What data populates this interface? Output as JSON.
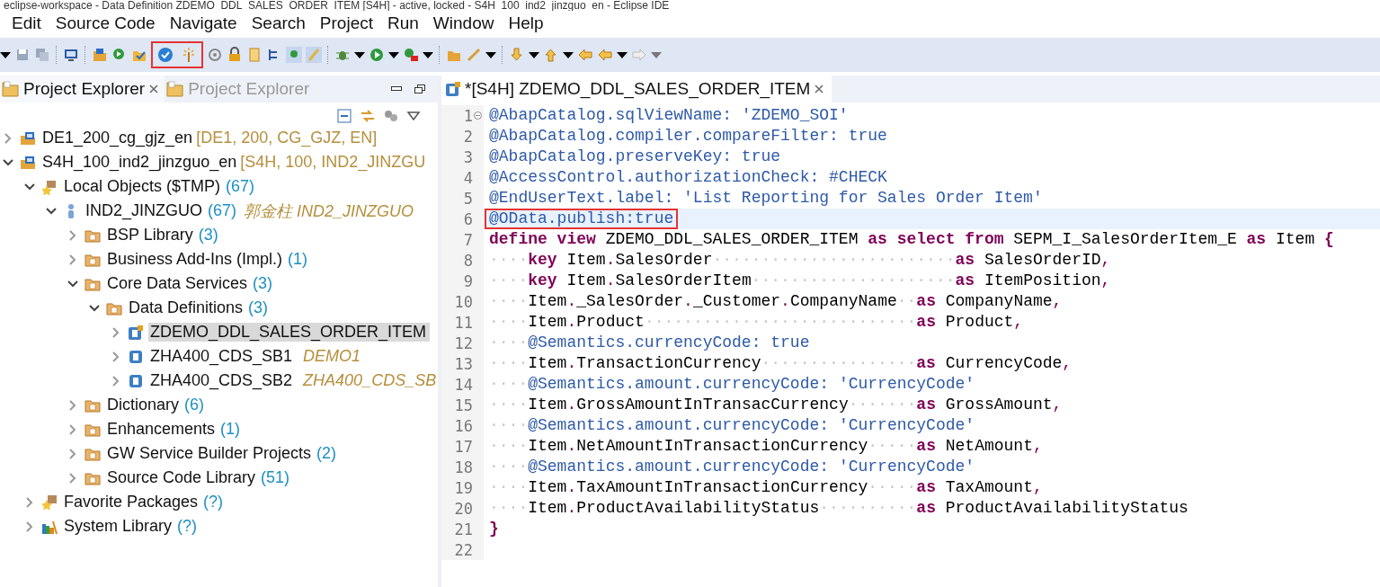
{
  "window": {
    "title": "eclipse-workspace - Data Definition ZDEMO_DDL_SALES_ORDER_ITEM [S4H] - active, locked - S4H_100_ind2_jinzguo_en - Eclipse IDE"
  },
  "menu": [
    {
      "label": "Edit"
    },
    {
      "label": "Source Code"
    },
    {
      "label": "Navigate"
    },
    {
      "label": "Search"
    },
    {
      "label": "Project"
    },
    {
      "label": "Run"
    },
    {
      "label": "Window"
    },
    {
      "label": "Help"
    }
  ],
  "toolbar": {
    "highlight_box": true
  },
  "explorer": {
    "tabs": [
      {
        "label": "Project Explorer",
        "selected": true
      },
      {
        "label": "Project Explorer",
        "selected": false
      }
    ],
    "tree": [
      {
        "kind": "system",
        "label": "DE1_200_cg_gjz_en",
        "decoration": "[DE1, 200, CG_GJZ, EN]",
        "expanded": false,
        "selected": false
      },
      {
        "kind": "system",
        "label": "S4H_100_ind2_jinzguo_en",
        "decoration": "[S4H, 100, IND2_JINZGU",
        "expanded": true,
        "selected": false,
        "children": [
          {
            "kind": "local",
            "label": "Local Objects ($TMP)",
            "count": "(67)",
            "expanded": true,
            "selected": false,
            "children": [
              {
                "kind": "user",
                "label": "IND2_JINZGUO",
                "count": "(67)",
                "description": "郭金柱 IND2_JINZGUO",
                "expanded": true,
                "selected": false,
                "children": [
                  {
                    "kind": "folder",
                    "label": "BSP Library",
                    "count": "(3)",
                    "expanded": false,
                    "selected": false
                  },
                  {
                    "kind": "folder",
                    "label": "Business Add-Ins (Impl.)",
                    "count": "(1)",
                    "expanded": false,
                    "selected": false
                  },
                  {
                    "kind": "folder",
                    "label": "Core Data Services",
                    "count": "(3)",
                    "expanded": true,
                    "selected": false,
                    "children": [
                      {
                        "kind": "folder",
                        "label": "Data Definitions",
                        "count": "(3)",
                        "expanded": true,
                        "selected": false,
                        "children": [
                          {
                            "kind": "ddl-locked",
                            "label": "ZDEMO_DDL_SALES_ORDER_ITEM",
                            "expanded": false,
                            "selected": true
                          },
                          {
                            "kind": "ddl",
                            "label": "ZHA400_CDS_SB1",
                            "description": "DEMO1",
                            "expanded": false,
                            "selected": false
                          },
                          {
                            "kind": "ddl",
                            "label": "ZHA400_CDS_SB2",
                            "description": "ZHA400_CDS_SB",
                            "expanded": false,
                            "selected": false
                          }
                        ]
                      }
                    ]
                  },
                  {
                    "kind": "folder",
                    "label": "Dictionary",
                    "count": "(6)",
                    "expanded": false,
                    "selected": false
                  },
                  {
                    "kind": "folder",
                    "label": "Enhancements",
                    "count": "(1)",
                    "expanded": false,
                    "selected": false
                  },
                  {
                    "kind": "folder",
                    "label": "GW Service Builder Projects",
                    "count": "(2)",
                    "expanded": false,
                    "selected": false
                  },
                  {
                    "kind": "folder",
                    "label": "Source Code Library",
                    "count": "(51)",
                    "expanded": false,
                    "selected": false
                  }
                ]
              }
            ]
          },
          {
            "kind": "favorites",
            "label": "Favorite Packages",
            "count": "(?)",
            "expanded": false,
            "selected": false
          },
          {
            "kind": "library",
            "label": "System Library",
            "count": "(?)",
            "expanded": false,
            "selected": false
          }
        ]
      }
    ]
  },
  "editor": {
    "tab": {
      "label": "*[S4H] ZDEMO_DDL_SALES_ORDER_ITEM"
    },
    "lines": [
      {
        "number": "1",
        "folded_marker": true,
        "current": false,
        "highlighted": false,
        "segments": [
          {
            "kind": "anno",
            "text": "@AbapCatalog.sqlViewName: 'ZDEMO_SOI'"
          }
        ]
      },
      {
        "number": "2",
        "current": false,
        "highlighted": false,
        "segments": [
          {
            "kind": "anno",
            "text": "@AbapCatalog.compiler.compareFilter: true"
          }
        ]
      },
      {
        "number": "3",
        "current": false,
        "highlighted": false,
        "segments": [
          {
            "kind": "anno",
            "text": "@AbapCatalog.preserveKey: true"
          }
        ]
      },
      {
        "number": "4",
        "current": false,
        "highlighted": false,
        "segments": [
          {
            "kind": "anno",
            "text": "@AccessControl.authorizationCheck: #CHECK"
          }
        ]
      },
      {
        "number": "5",
        "current": false,
        "highlighted": false,
        "segments": [
          {
            "kind": "anno",
            "text": "@EndUserText.label: 'List Reporting for Sales Order Item'"
          }
        ]
      },
      {
        "number": "6",
        "current": true,
        "highlighted": true,
        "segments": [
          {
            "kind": "anno",
            "text": "@OData.publish:true"
          }
        ]
      },
      {
        "number": "7",
        "current": false,
        "highlighted": false,
        "segments": [
          {
            "kind": "keyword",
            "text": "define view"
          },
          {
            "kind": "plain",
            "text": " ZDEMO_DDL_SALES_ORDER_ITEM "
          },
          {
            "kind": "keyword",
            "text": "as select from"
          },
          {
            "kind": "plain",
            "text": " SEPM_I_SalesOrderItem_E "
          },
          {
            "kind": "keyword",
            "text": "as"
          },
          {
            "kind": "plain",
            "text": " Item "
          },
          {
            "kind": "keyword",
            "text": "{"
          }
        ]
      },
      {
        "number": "8",
        "current": false,
        "highlighted": false,
        "segments": [
          {
            "kind": "ws",
            "text": "····"
          },
          {
            "kind": "keyword",
            "text": "key"
          },
          {
            "kind": "plain",
            "text": " Item"
          },
          {
            "kind": "punct",
            "text": "."
          },
          {
            "kind": "plain",
            "text": "SalesOrder"
          },
          {
            "kind": "ws",
            "text": "·························"
          },
          {
            "kind": "keyword",
            "text": "as"
          },
          {
            "kind": "plain",
            "text": " SalesOrderID"
          },
          {
            "kind": "punct",
            "text": ","
          }
        ]
      },
      {
        "number": "9",
        "current": false,
        "highlighted": false,
        "segments": [
          {
            "kind": "ws",
            "text": "····"
          },
          {
            "kind": "keyword",
            "text": "key"
          },
          {
            "kind": "plain",
            "text": " Item"
          },
          {
            "kind": "punct",
            "text": "."
          },
          {
            "kind": "plain",
            "text": "SalesOrderItem"
          },
          {
            "kind": "ws",
            "text": "·····················"
          },
          {
            "kind": "keyword",
            "text": "as"
          },
          {
            "kind": "plain",
            "text": " ItemPosition"
          },
          {
            "kind": "punct",
            "text": ","
          }
        ]
      },
      {
        "number": "10",
        "current": false,
        "highlighted": false,
        "segments": [
          {
            "kind": "ws",
            "text": "····"
          },
          {
            "kind": "plain",
            "text": "Item"
          },
          {
            "kind": "punct",
            "text": "."
          },
          {
            "kind": "plain",
            "text": "_SalesOrder"
          },
          {
            "kind": "punct",
            "text": "."
          },
          {
            "kind": "plain",
            "text": "_Customer"
          },
          {
            "kind": "punct",
            "text": "."
          },
          {
            "kind": "plain",
            "text": "CompanyName"
          },
          {
            "kind": "ws",
            "text": "··"
          },
          {
            "kind": "keyword",
            "text": "as"
          },
          {
            "kind": "plain",
            "text": " CompanyName"
          },
          {
            "kind": "punct",
            "text": ","
          }
        ]
      },
      {
        "number": "11",
        "current": false,
        "highlighted": false,
        "segments": [
          {
            "kind": "ws",
            "text": "····"
          },
          {
            "kind": "plain",
            "text": "Item"
          },
          {
            "kind": "punct",
            "text": "."
          },
          {
            "kind": "plain",
            "text": "Product"
          },
          {
            "kind": "ws",
            "text": "····························"
          },
          {
            "kind": "keyword",
            "text": "as"
          },
          {
            "kind": "plain",
            "text": " Product"
          },
          {
            "kind": "punct",
            "text": ","
          }
        ]
      },
      {
        "number": "12",
        "current": false,
        "highlighted": false,
        "segments": [
          {
            "kind": "ws",
            "text": "····"
          },
          {
            "kind": "anno",
            "text": "@Semantics.currencyCode: true"
          }
        ]
      },
      {
        "number": "13",
        "current": false,
        "highlighted": false,
        "segments": [
          {
            "kind": "ws",
            "text": "····"
          },
          {
            "kind": "plain",
            "text": "Item"
          },
          {
            "kind": "punct",
            "text": "."
          },
          {
            "kind": "plain",
            "text": "TransactionCurrency"
          },
          {
            "kind": "ws",
            "text": "················"
          },
          {
            "kind": "keyword",
            "text": "as"
          },
          {
            "kind": "plain",
            "text": " CurrencyCode"
          },
          {
            "kind": "punct",
            "text": ","
          }
        ]
      },
      {
        "number": "14",
        "current": false,
        "highlighted": false,
        "segments": [
          {
            "kind": "ws",
            "text": "····"
          },
          {
            "kind": "anno",
            "text": "@Semantics.amount.currencyCode: 'CurrencyCode'"
          }
        ]
      },
      {
        "number": "15",
        "current": false,
        "highlighted": false,
        "segments": [
          {
            "kind": "ws",
            "text": "····"
          },
          {
            "kind": "plain",
            "text": "Item"
          },
          {
            "kind": "punct",
            "text": "."
          },
          {
            "kind": "plain",
            "text": "GrossAmountInTransacCurrency"
          },
          {
            "kind": "ws",
            "text": "·······"
          },
          {
            "kind": "keyword",
            "text": "as"
          },
          {
            "kind": "plain",
            "text": " GrossAmount"
          },
          {
            "kind": "punct",
            "text": ","
          }
        ]
      },
      {
        "number": "16",
        "current": false,
        "highlighted": false,
        "segments": [
          {
            "kind": "ws",
            "text": "····"
          },
          {
            "kind": "anno",
            "text": "@Semantics.amount.currencyCode: 'CurrencyCode'"
          }
        ]
      },
      {
        "number": "17",
        "current": false,
        "highlighted": false,
        "segments": [
          {
            "kind": "ws",
            "text": "····"
          },
          {
            "kind": "plain",
            "text": "Item"
          },
          {
            "kind": "punct",
            "text": "."
          },
          {
            "kind": "plain",
            "text": "NetAmountInTransactionCurrency"
          },
          {
            "kind": "ws",
            "text": "·····"
          },
          {
            "kind": "keyword",
            "text": "as"
          },
          {
            "kind": "plain",
            "text": " NetAmount"
          },
          {
            "kind": "punct",
            "text": ","
          }
        ]
      },
      {
        "number": "18",
        "current": false,
        "highlighted": false,
        "segments": [
          {
            "kind": "ws",
            "text": "····"
          },
          {
            "kind": "anno",
            "text": "@Semantics.amount.currencyCode: 'CurrencyCode'"
          }
        ]
      },
      {
        "number": "19",
        "current": false,
        "highlighted": false,
        "segments": [
          {
            "kind": "ws",
            "text": "····"
          },
          {
            "kind": "plain",
            "text": "Item"
          },
          {
            "kind": "punct",
            "text": "."
          },
          {
            "kind": "plain",
            "text": "TaxAmountInTransactionCurrency"
          },
          {
            "kind": "ws",
            "text": "·····"
          },
          {
            "kind": "keyword",
            "text": "as"
          },
          {
            "kind": "plain",
            "text": " TaxAmount"
          },
          {
            "kind": "punct",
            "text": ","
          }
        ]
      },
      {
        "number": "20",
        "current": false,
        "highlighted": false,
        "segments": [
          {
            "kind": "ws",
            "text": "····"
          },
          {
            "kind": "plain",
            "text": "Item"
          },
          {
            "kind": "punct",
            "text": "."
          },
          {
            "kind": "plain",
            "text": "ProductAvailabilityStatus"
          },
          {
            "kind": "ws",
            "text": "··········"
          },
          {
            "kind": "keyword",
            "text": "as"
          },
          {
            "kind": "plain",
            "text": " ProductAvailabilityStatus"
          }
        ]
      },
      {
        "number": "21",
        "current": false,
        "highlighted": false,
        "segments": [
          {
            "kind": "keyword",
            "text": "}"
          }
        ]
      },
      {
        "number": "22",
        "current": false,
        "highlighted": false
      }
    ]
  }
}
